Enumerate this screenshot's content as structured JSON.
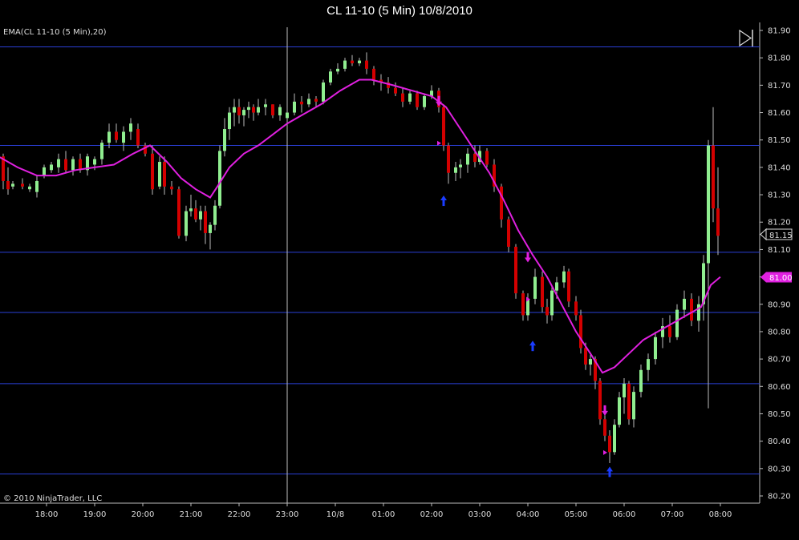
{
  "header": {
    "title": "CL 11-10 (5 Min)  10/8/2010"
  },
  "indicator_label": "EMA(CL 11-10 (5 Min),20)",
  "copyright": "© 2010 NinjaTrader, LLC",
  "last_price_label": "81.15",
  "ema_price_label": "81.00",
  "play_icon": "skip-to-end-icon",
  "colors": {
    "background": "#000000",
    "up_candle": "#90ee90",
    "down_candle": "#d40000",
    "ema_line": "#e020e0",
    "horizontal_lines": "#2a3fd6",
    "vertical_line": "#c0c0c0",
    "buy_arrow": "#1a3cff",
    "sell_arrow": "#e020e0",
    "ema_tag": "#e020e0"
  },
  "chart_data": {
    "type": "candlestick",
    "title": "CL 11-10 (5 Min)  10/8/2010",
    "x_tick_labels": [
      "18:00",
      "19:00",
      "20:00",
      "21:00",
      "22:00",
      "23:00",
      "10/8",
      "01:00",
      "02:00",
      "03:00",
      "04:00",
      "05:00",
      "06:00",
      "07:00",
      "08:00"
    ],
    "y_tick_labels": [
      "81.90",
      "81.80",
      "81.70",
      "81.60",
      "81.50",
      "81.40",
      "81.30",
      "81.20",
      "81.10",
      "81.00",
      "80.90",
      "80.80",
      "80.70",
      "80.60",
      "80.50",
      "80.40",
      "80.30",
      "80.20"
    ],
    "ylim": [
      80.18,
      81.93
    ],
    "horizontal_lines": [
      81.84,
      81.48,
      81.09,
      80.87,
      80.61,
      80.28
    ],
    "vertical_line_time": 23.0,
    "ema_period": 20,
    "series": [
      {
        "name": "EMA(CL 11-10 (5 Min),20)",
        "type": "line",
        "points": [
          [
            17.0,
            81.44
          ],
          [
            17.4,
            81.4
          ],
          [
            17.8,
            81.37
          ],
          [
            18.2,
            81.37
          ],
          [
            18.6,
            81.39
          ],
          [
            19.0,
            81.4
          ],
          [
            19.4,
            81.41
          ],
          [
            19.8,
            81.45
          ],
          [
            20.15,
            81.48
          ],
          [
            20.5,
            81.42
          ],
          [
            20.8,
            81.36
          ],
          [
            21.1,
            81.32
          ],
          [
            21.4,
            81.29
          ],
          [
            21.55,
            81.33
          ],
          [
            21.8,
            81.4
          ],
          [
            22.1,
            81.45
          ],
          [
            22.4,
            81.48
          ],
          [
            22.7,
            81.52
          ],
          [
            23.0,
            81.56
          ],
          [
            23.3,
            81.59
          ],
          [
            23.7,
            81.63
          ],
          [
            24.1,
            81.68
          ],
          [
            24.5,
            81.72
          ],
          [
            24.75,
            81.72
          ],
          [
            25.2,
            81.7
          ],
          [
            25.6,
            81.68
          ],
          [
            26.0,
            81.66
          ],
          [
            26.3,
            81.62
          ],
          [
            26.6,
            81.54
          ],
          [
            26.9,
            81.46
          ],
          [
            27.2,
            81.38
          ],
          [
            27.5,
            81.28
          ],
          [
            27.8,
            81.17
          ],
          [
            28.1,
            81.08
          ],
          [
            28.4,
            81.0
          ],
          [
            28.7,
            80.9
          ],
          [
            29.0,
            80.8
          ],
          [
            29.3,
            80.72
          ],
          [
            29.55,
            80.65
          ],
          [
            29.8,
            80.67
          ],
          [
            30.1,
            80.72
          ],
          [
            30.4,
            80.77
          ],
          [
            30.7,
            80.8
          ],
          [
            31.0,
            80.83
          ],
          [
            31.3,
            80.86
          ],
          [
            31.6,
            80.89
          ],
          [
            31.8,
            80.97
          ],
          [
            32.0,
            81.0
          ]
        ]
      }
    ],
    "candles": [
      [
        17.0,
        81.5,
        81.52,
        81.4,
        81.44
      ],
      [
        17.1,
        81.44,
        81.45,
        81.32,
        81.35
      ],
      [
        17.2,
        81.35,
        81.4,
        81.3,
        81.32
      ],
      [
        17.3,
        81.33,
        81.35,
        81.32,
        81.34
      ],
      [
        17.5,
        81.34,
        81.36,
        81.32,
        81.33
      ],
      [
        17.65,
        81.32,
        81.34,
        81.31,
        81.33
      ],
      [
        17.8,
        81.31,
        81.37,
        81.29,
        81.35
      ],
      [
        17.95,
        81.37,
        81.41,
        81.36,
        81.4
      ],
      [
        18.1,
        81.39,
        81.42,
        81.38,
        81.41
      ],
      [
        18.25,
        81.4,
        81.45,
        81.38,
        81.43
      ],
      [
        18.4,
        81.43,
        81.46,
        81.38,
        81.39
      ],
      [
        18.55,
        81.39,
        81.44,
        81.37,
        81.43
      ],
      [
        18.7,
        81.43,
        81.45,
        81.38,
        81.39
      ],
      [
        18.85,
        81.39,
        81.45,
        81.37,
        81.44
      ],
      [
        19.0,
        81.41,
        81.44,
        81.39,
        81.43
      ],
      [
        19.15,
        81.43,
        81.5,
        81.41,
        81.49
      ],
      [
        19.3,
        81.49,
        81.56,
        81.47,
        81.53
      ],
      [
        19.45,
        81.53,
        81.56,
        81.49,
        81.5
      ],
      [
        19.6,
        81.49,
        81.55,
        81.46,
        81.53
      ],
      [
        19.75,
        81.53,
        81.58,
        81.5,
        81.56
      ],
      [
        19.9,
        81.54,
        81.56,
        81.47,
        81.48
      ],
      [
        20.05,
        81.48,
        81.49,
        81.44,
        81.45
      ],
      [
        20.2,
        81.45,
        81.48,
        81.3,
        81.32
      ],
      [
        20.35,
        81.33,
        81.44,
        81.32,
        81.42
      ],
      [
        20.45,
        81.42,
        81.44,
        81.3,
        81.33
      ],
      [
        20.6,
        81.33,
        81.35,
        81.3,
        81.32
      ],
      [
        20.75,
        81.32,
        81.33,
        81.14,
        81.15
      ],
      [
        20.9,
        81.15,
        81.26,
        81.13,
        81.24
      ],
      [
        21.0,
        81.24,
        81.3,
        81.22,
        81.25
      ],
      [
        21.1,
        81.25,
        81.28,
        81.2,
        81.21
      ],
      [
        21.2,
        81.21,
        81.26,
        81.17,
        81.24
      ],
      [
        21.3,
        81.24,
        81.26,
        81.12,
        81.16
      ],
      [
        21.4,
        81.16,
        81.2,
        81.1,
        81.19
      ],
      [
        21.5,
        81.19,
        81.28,
        81.17,
        81.26
      ],
      [
        21.6,
        81.26,
        81.48,
        81.25,
        81.46
      ],
      [
        21.7,
        81.46,
        81.58,
        81.44,
        81.54
      ],
      [
        21.8,
        81.54,
        81.62,
        81.5,
        81.6
      ],
      [
        21.9,
        81.6,
        81.65,
        81.55,
        81.62
      ],
      [
        22.0,
        81.62,
        81.65,
        81.56,
        81.59
      ],
      [
        22.1,
        81.59,
        81.62,
        81.55,
        81.61
      ],
      [
        22.2,
        81.61,
        81.64,
        81.58,
        81.62
      ],
      [
        22.3,
        81.62,
        81.63,
        81.57,
        81.6
      ],
      [
        22.4,
        81.6,
        81.65,
        81.59,
        81.62
      ],
      [
        22.55,
        81.62,
        81.65,
        81.59,
        81.63
      ],
      [
        22.7,
        81.63,
        81.63,
        81.58,
        81.59
      ],
      [
        22.85,
        81.59,
        81.63,
        81.57,
        81.62
      ],
      [
        23.0,
        81.58,
        81.62,
        81.55,
        81.6
      ],
      [
        23.15,
        81.6,
        81.67,
        81.59,
        81.64
      ],
      [
        23.3,
        81.64,
        81.66,
        81.6,
        81.63
      ],
      [
        23.45,
        81.63,
        81.67,
        81.62,
        81.65
      ],
      [
        23.6,
        81.65,
        81.66,
        81.62,
        81.64
      ],
      [
        23.75,
        81.64,
        81.72,
        81.63,
        81.71
      ],
      [
        23.9,
        81.71,
        81.76,
        81.7,
        81.75
      ],
      [
        24.05,
        81.75,
        81.78,
        81.74,
        81.76
      ],
      [
        24.2,
        81.76,
        81.8,
        81.75,
        81.79
      ],
      [
        24.35,
        81.79,
        81.81,
        81.77,
        81.78
      ],
      [
        24.5,
        81.78,
        81.8,
        81.77,
        81.79
      ],
      [
        24.65,
        81.79,
        81.82,
        81.74,
        81.76
      ],
      [
        24.8,
        81.76,
        81.77,
        81.7,
        81.72
      ],
      [
        24.95,
        81.72,
        81.74,
        81.68,
        81.71
      ],
      [
        25.1,
        81.71,
        81.73,
        81.67,
        81.69
      ],
      [
        25.25,
        81.69,
        81.71,
        81.66,
        81.67
      ],
      [
        25.4,
        81.67,
        81.69,
        81.62,
        81.64
      ],
      [
        25.55,
        81.64,
        81.68,
        81.63,
        81.67
      ],
      [
        25.7,
        81.67,
        81.68,
        81.61,
        81.62
      ],
      [
        25.85,
        81.62,
        81.67,
        81.61,
        81.66
      ],
      [
        26.0,
        81.66,
        81.7,
        81.65,
        81.68
      ],
      [
        26.15,
        81.68,
        81.69,
        81.6,
        81.62
      ],
      [
        26.25,
        81.62,
        81.63,
        81.46,
        81.48
      ],
      [
        26.35,
        81.48,
        81.49,
        81.34,
        81.38
      ],
      [
        26.5,
        81.38,
        81.42,
        81.35,
        81.4
      ],
      [
        26.6,
        81.4,
        81.43,
        81.36,
        81.41
      ],
      [
        26.75,
        81.41,
        81.47,
        81.38,
        81.45
      ],
      [
        26.9,
        81.45,
        81.48,
        81.4,
        81.42
      ],
      [
        27.0,
        81.42,
        81.48,
        81.41,
        81.46
      ],
      [
        27.15,
        81.46,
        81.47,
        81.4,
        81.41
      ],
      [
        27.3,
        81.41,
        81.43,
        81.31,
        81.33
      ],
      [
        27.45,
        81.33,
        81.34,
        81.18,
        81.21
      ],
      [
        27.6,
        81.21,
        81.22,
        81.09,
        81.11
      ],
      [
        27.75,
        81.11,
        81.12,
        80.92,
        80.94
      ],
      [
        27.9,
        80.94,
        80.95,
        80.84,
        80.86
      ],
      [
        28.0,
        80.86,
        80.94,
        80.84,
        80.92
      ],
      [
        28.15,
        80.92,
        81.03,
        80.9,
        81.0
      ],
      [
        28.3,
        81.0,
        81.02,
        80.87,
        80.89
      ],
      [
        28.4,
        80.89,
        80.92,
        80.83,
        80.86
      ],
      [
        28.5,
        80.86,
        80.97,
        80.84,
        80.95
      ],
      [
        28.6,
        80.95,
        81.0,
        80.92,
        80.98
      ],
      [
        28.75,
        80.98,
        81.04,
        80.96,
        81.02
      ],
      [
        28.85,
        81.02,
        81.03,
        80.89,
        80.91
      ],
      [
        29.0,
        80.91,
        80.93,
        80.84,
        80.86
      ],
      [
        29.1,
        80.86,
        80.88,
        80.72,
        80.74
      ],
      [
        29.2,
        80.74,
        80.76,
        80.66,
        80.68
      ],
      [
        29.3,
        80.68,
        80.72,
        80.64,
        80.7
      ],
      [
        29.4,
        80.7,
        80.71,
        80.59,
        80.62
      ],
      [
        29.5,
        80.62,
        80.63,
        80.46,
        80.48
      ],
      [
        29.6,
        80.48,
        80.5,
        80.4,
        80.42
      ],
      [
        29.7,
        80.42,
        80.44,
        80.32,
        80.36
      ],
      [
        29.8,
        80.36,
        80.48,
        80.35,
        80.46
      ],
      [
        29.9,
        80.46,
        80.58,
        80.45,
        80.56
      ],
      [
        30.0,
        80.56,
        80.63,
        80.5,
        80.61
      ],
      [
        30.1,
        80.61,
        80.62,
        80.46,
        80.48
      ],
      [
        30.2,
        80.48,
        80.6,
        80.45,
        80.58
      ],
      [
        30.35,
        80.58,
        80.68,
        80.56,
        80.66
      ],
      [
        30.5,
        80.66,
        80.72,
        80.62,
        80.7
      ],
      [
        30.65,
        80.7,
        80.8,
        80.68,
        80.78
      ],
      [
        30.8,
        80.78,
        80.85,
        80.74,
        80.82
      ],
      [
        30.95,
        80.82,
        80.86,
        80.76,
        80.78
      ],
      [
        31.1,
        80.78,
        80.9,
        80.77,
        80.88
      ],
      [
        31.25,
        80.88,
        80.95,
        80.85,
        80.92
      ],
      [
        31.4,
        80.92,
        80.94,
        80.82,
        80.84
      ],
      [
        31.55,
        80.84,
        80.93,
        80.8,
        80.9
      ],
      [
        31.65,
        80.9,
        81.08,
        80.84,
        81.05
      ],
      [
        31.75,
        81.05,
        81.5,
        80.52,
        81.48
      ],
      [
        31.85,
        81.48,
        81.62,
        81.2,
        81.25
      ],
      [
        31.95,
        81.25,
        81.4,
        81.08,
        81.15
      ]
    ],
    "markers": [
      {
        "type": "sell",
        "x": 26.15,
        "y": 81.62
      },
      {
        "type": "buy",
        "x": 26.25,
        "y": 81.3
      },
      {
        "type": "sell",
        "x": 28.0,
        "y": 81.05
      },
      {
        "type": "buy",
        "x": 28.1,
        "y": 80.77
      },
      {
        "type": "sell",
        "x": 29.6,
        "y": 80.49
      },
      {
        "type": "buy",
        "x": 29.7,
        "y": 80.31
      }
    ]
  }
}
